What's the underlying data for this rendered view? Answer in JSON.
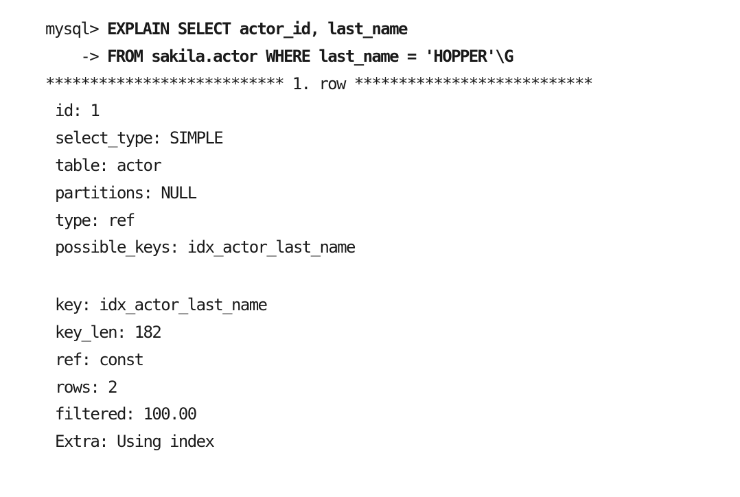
{
  "console": {
    "prompt": "mysql>",
    "query_line1": " EXPLAIN SELECT actor_id, last_name",
    "continuation_prompt": "    ->",
    "query_line2": " FROM sakila.actor WHERE last_name = 'HOPPER'\\G",
    "row_header": "*************************** 1. row ***************************"
  },
  "fields": [
    {
      "label": "id",
      "value": "1"
    },
    {
      "label": "select_type",
      "value": "SIMPLE"
    },
    {
      "label": "table",
      "value": "actor"
    },
    {
      "label": "partitions",
      "value": "NULL"
    },
    {
      "label": "type",
      "value": "ref"
    },
    {
      "label": "possible_keys",
      "value": "idx_actor_last_name"
    },
    {
      "label": "key",
      "value": "idx_actor_last_name"
    },
    {
      "label": "key_len",
      "value": "182"
    },
    {
      "label": "ref",
      "value": "const"
    },
    {
      "label": "rows",
      "value": "2"
    },
    {
      "label": "filtered",
      "value": "100.00"
    },
    {
      "label": "Extra",
      "value": "Using index"
    }
  ]
}
